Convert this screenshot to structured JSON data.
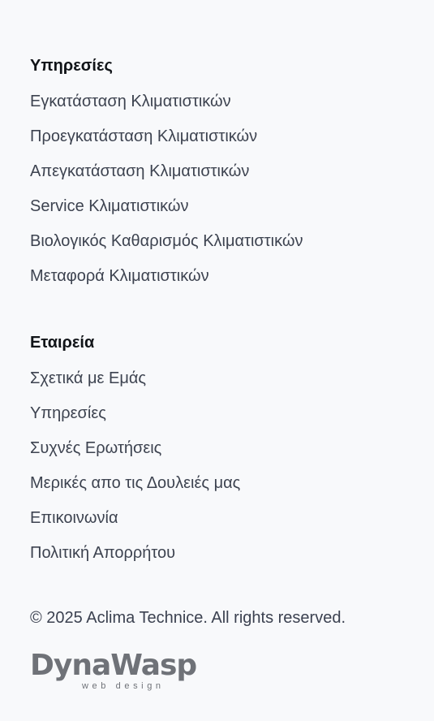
{
  "services": {
    "title": "Υπηρεσίες",
    "items": [
      "Εγκατάσταση Κλιματιστικών",
      "Προεγκατάσταση Κλιματιστικών",
      "Απεγκατάσταση Κλιματιστικών",
      "Service Κλιματιστικών",
      "Βιολογικός Καθαρισμός Κλιματιστικών",
      "Μεταφορά Κλιματιστικών"
    ]
  },
  "company": {
    "title": "Εταιρεία",
    "items": [
      "Σχετικά με Εμάς",
      "Υπηρεσίες",
      "Συχνές Ερωτήσεις",
      "Μερικές απο τις Δουλειές μας",
      "Επικοινωνία",
      "Πολιτική Απορρήτου"
    ]
  },
  "copyright": "© 2025 Aclima Technice. All rights reserved.",
  "logo": {
    "name": "DynaWasp",
    "tagline": "web design"
  }
}
